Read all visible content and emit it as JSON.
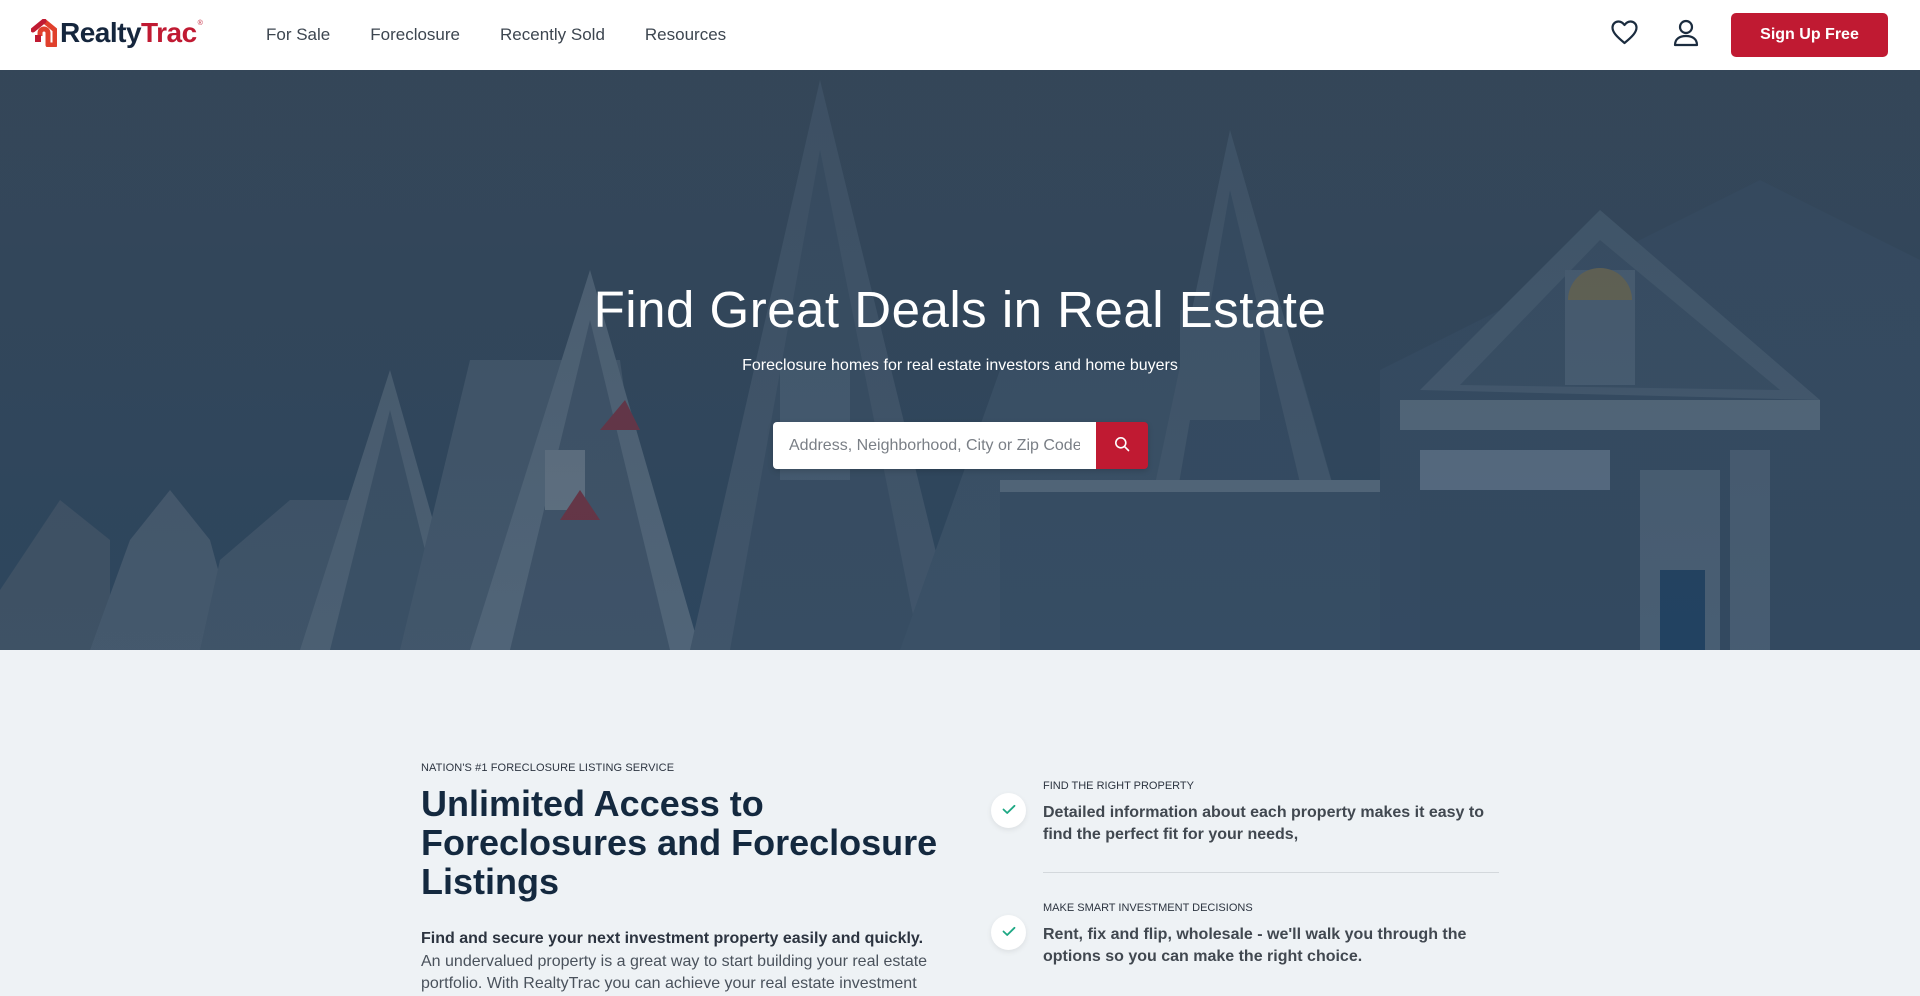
{
  "header": {
    "logo": {
      "part1": "Realty",
      "part2": "Trac",
      "reg": "®"
    },
    "nav": [
      {
        "label": "For Sale"
      },
      {
        "label": "Foreclosure"
      },
      {
        "label": "Recently Sold"
      },
      {
        "label": "Resources"
      }
    ],
    "icons": {
      "favorites": "heart-icon",
      "account": "user-icon"
    },
    "signup_label": "Sign Up Free"
  },
  "hero": {
    "title": "Find Great Deals in Real Estate",
    "subtitle": "Foreclosure homes for real estate investors and home buyers",
    "search": {
      "placeholder": "Address, Neighborhood, City or Zip Code",
      "value": "",
      "button_icon": "search-icon"
    }
  },
  "intro": {
    "eyebrow": "NATION'S #1 FORECLOSURE LISTING SERVICE",
    "headline": "Unlimited Access to Foreclosures and Foreclosure Listings",
    "body_bold": "Find and secure your next investment property easily and quickly.",
    "body_rest": " An undervalued property is a great way to start building your real estate portfolio. With RealtyTrac you can achieve your real estate investment"
  },
  "features": [
    {
      "label": "FIND THE RIGHT PROPERTY",
      "text": "Detailed information about each property makes it easy to find the perfect fit for your needs,",
      "icon": "check-icon"
    },
    {
      "label": "MAKE SMART INVESTMENT DECISIONS",
      "text": "Rent, fix and flip, wholesale - we'll walk you through the options so you can make the right choice.",
      "icon": "check-icon"
    }
  ],
  "colors": {
    "brand_red": "#c01a32",
    "brand_navy": "#15263d",
    "check_green": "#1ea884",
    "section_bg": "#eef2f5"
  }
}
